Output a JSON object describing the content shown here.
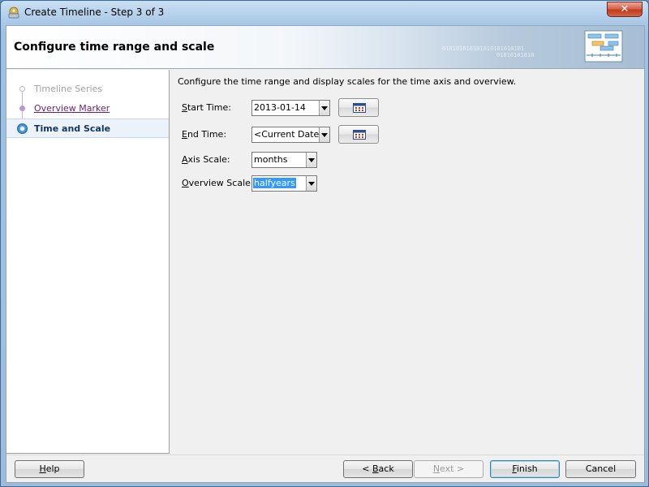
{
  "window": {
    "title": "Create Timeline - Step 3 of 3",
    "close_label": "✕"
  },
  "header": {
    "title": "Configure time range and scale",
    "binary_line1": "010101010101010101010101",
    "binary_line2": "01010101010"
  },
  "nav": {
    "steps": [
      {
        "label": "Timeline Series",
        "state": "done"
      },
      {
        "label": "Overview Marker",
        "state": "visited"
      },
      {
        "label": "Time and Scale",
        "state": "current"
      }
    ]
  },
  "form": {
    "intro": "Configure the time range and display scales for the time axis and overview.",
    "start_time": {
      "label_mnemonic": "S",
      "label_rest": "tart Time:",
      "value": "2013-01-14"
    },
    "end_time": {
      "label_mnemonic": "E",
      "label_rest": "nd Time:",
      "value": "<Current Date>"
    },
    "axis_scale": {
      "label_mnemonic": "A",
      "label_rest": "xis Scale:",
      "value": "months"
    },
    "overview_scale": {
      "label_mnemonic": "O",
      "label_rest": "verview Scale:",
      "value": "halfyears"
    }
  },
  "footer": {
    "help": {
      "mnemonic": "H",
      "rest": "elp"
    },
    "back": {
      "prefix": "< ",
      "mnemonic": "B",
      "rest": "ack"
    },
    "next": {
      "mnemonic": "N",
      "rest": "ext >"
    },
    "finish": {
      "mnemonic": "F",
      "rest": "inish"
    },
    "cancel": "Cancel"
  },
  "colors": {
    "accent": "#3399ff",
    "visited_link": "#6a1f73",
    "current_step": "#15365f"
  }
}
